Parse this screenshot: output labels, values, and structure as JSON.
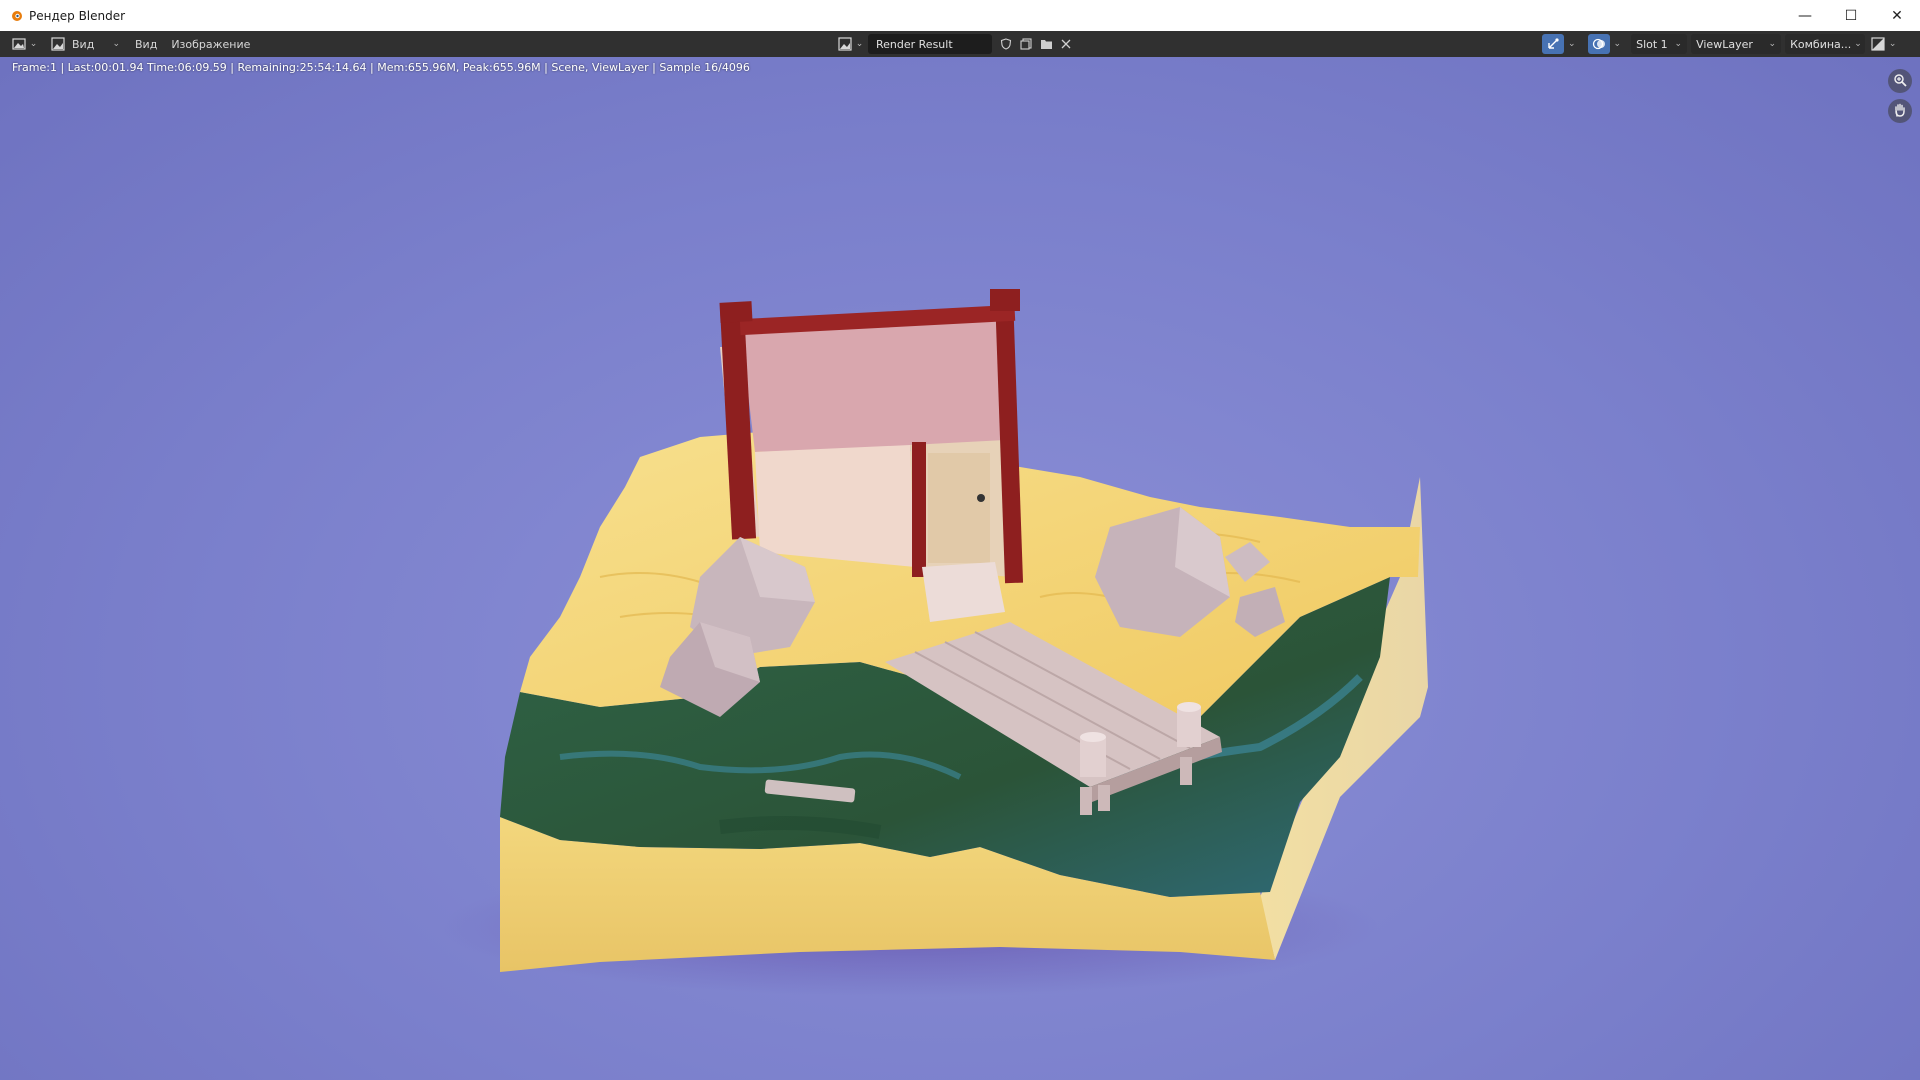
{
  "window": {
    "title": "Рендер Blender",
    "controls": {
      "minimize": "—",
      "maximize": "☐",
      "close": "✕"
    }
  },
  "header": {
    "editor_type_icon": "image-editor-icon",
    "mode_icon": "image-mode-icon",
    "mode_label": "Вид",
    "menus": [
      "Вид",
      "Изображение"
    ],
    "image_browse_icon": "image-browse-icon",
    "image_name": "Render Result",
    "slot": "Slot 1",
    "view_layer": "ViewLayer",
    "pass": "Комбина...",
    "icons": {
      "fake_user": "shield-icon",
      "new_image": "new-image-icon",
      "open_image": "folder-icon",
      "unlink": "close-icon",
      "gizmo": "gizmo-icon",
      "overlay": "overlay-icon",
      "display_channels": "display-channels-icon"
    }
  },
  "viewport": {
    "stats": "Frame:1 | Last:00:01.94 Time:06:09.59 | Remaining:25:54:14.64 | Mem:655.96M, Peak:655.96M | Scene, ViewLayer | Sample 16/4096",
    "nav": {
      "zoom_icon": "zoom-icon",
      "pan_icon": "hand-pan-icon"
    }
  },
  "colors": {
    "background": "#7f83c9",
    "sand": "#f2d27c",
    "water": "#2f5a3a",
    "roof": "#d9a7ae",
    "trim": "#8e1f1f",
    "walls": "#e8c9c0"
  }
}
